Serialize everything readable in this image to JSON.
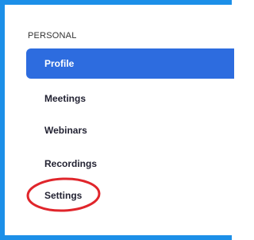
{
  "sidebar": {
    "section_title": "PERSONAL",
    "items": [
      {
        "label": "Profile",
        "active": true
      },
      {
        "label": "Meetings",
        "active": false
      },
      {
        "label": "Webinars",
        "active": false
      },
      {
        "label": "Recordings",
        "active": false
      },
      {
        "label": "Settings",
        "active": false
      }
    ]
  },
  "colors": {
    "frame_border": "#1c8fe8",
    "active_background": "#2d6cdf",
    "annotation_circle": "#e0252b"
  }
}
